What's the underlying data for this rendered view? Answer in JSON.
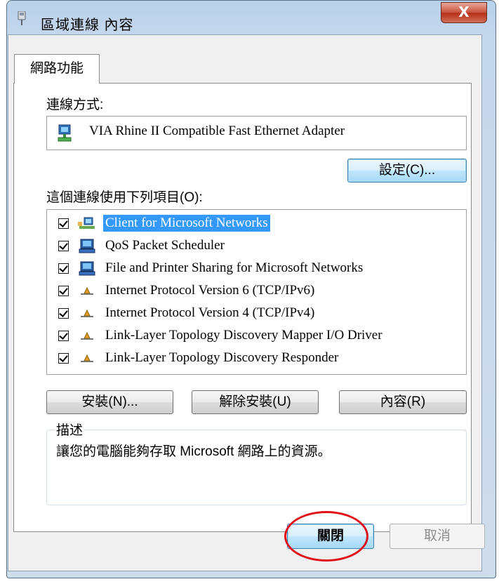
{
  "window": {
    "title": "區域連線 內容",
    "close_label": "X"
  },
  "tabs": [
    {
      "label": "網路功能"
    }
  ],
  "connect_using": {
    "label": "連線方式:",
    "adapter_name": "VIA Rhine II Compatible Fast Ethernet Adapter",
    "configure_button": "設定(C)..."
  },
  "items_section": {
    "label": "這個連線使用下列項目(O):",
    "items": [
      {
        "label": "Client for Microsoft Networks",
        "checked": true,
        "selected": true,
        "icon": "network-client-icon"
      },
      {
        "label": "QoS Packet Scheduler",
        "checked": true,
        "selected": false,
        "icon": "computer-service-icon"
      },
      {
        "label": "File and Printer Sharing for Microsoft Networks",
        "checked": true,
        "selected": false,
        "icon": "computer-service-icon"
      },
      {
        "label": "Internet Protocol Version 6 (TCP/IPv6)",
        "checked": true,
        "selected": false,
        "icon": "protocol-icon"
      },
      {
        "label": "Internet Protocol Version 4 (TCP/IPv4)",
        "checked": true,
        "selected": false,
        "icon": "protocol-icon"
      },
      {
        "label": "Link-Layer Topology Discovery Mapper I/O Driver",
        "checked": true,
        "selected": false,
        "icon": "protocol-icon"
      },
      {
        "label": "Link-Layer Topology Discovery Responder",
        "checked": true,
        "selected": false,
        "icon": "protocol-icon"
      }
    ]
  },
  "action_buttons": {
    "install": "安裝(N)...",
    "uninstall": "解除安裝(U)",
    "properties": "內容(R)"
  },
  "description": {
    "legend": "描述",
    "text": "讓您的電腦能夠存取 Microsoft 網路上的資源。"
  },
  "footer": {
    "close": "關閉",
    "cancel": "取消"
  },
  "colors": {
    "selection": "#3399ff",
    "annotation_circle": "#e0101a",
    "close_button": "#c7503a"
  }
}
